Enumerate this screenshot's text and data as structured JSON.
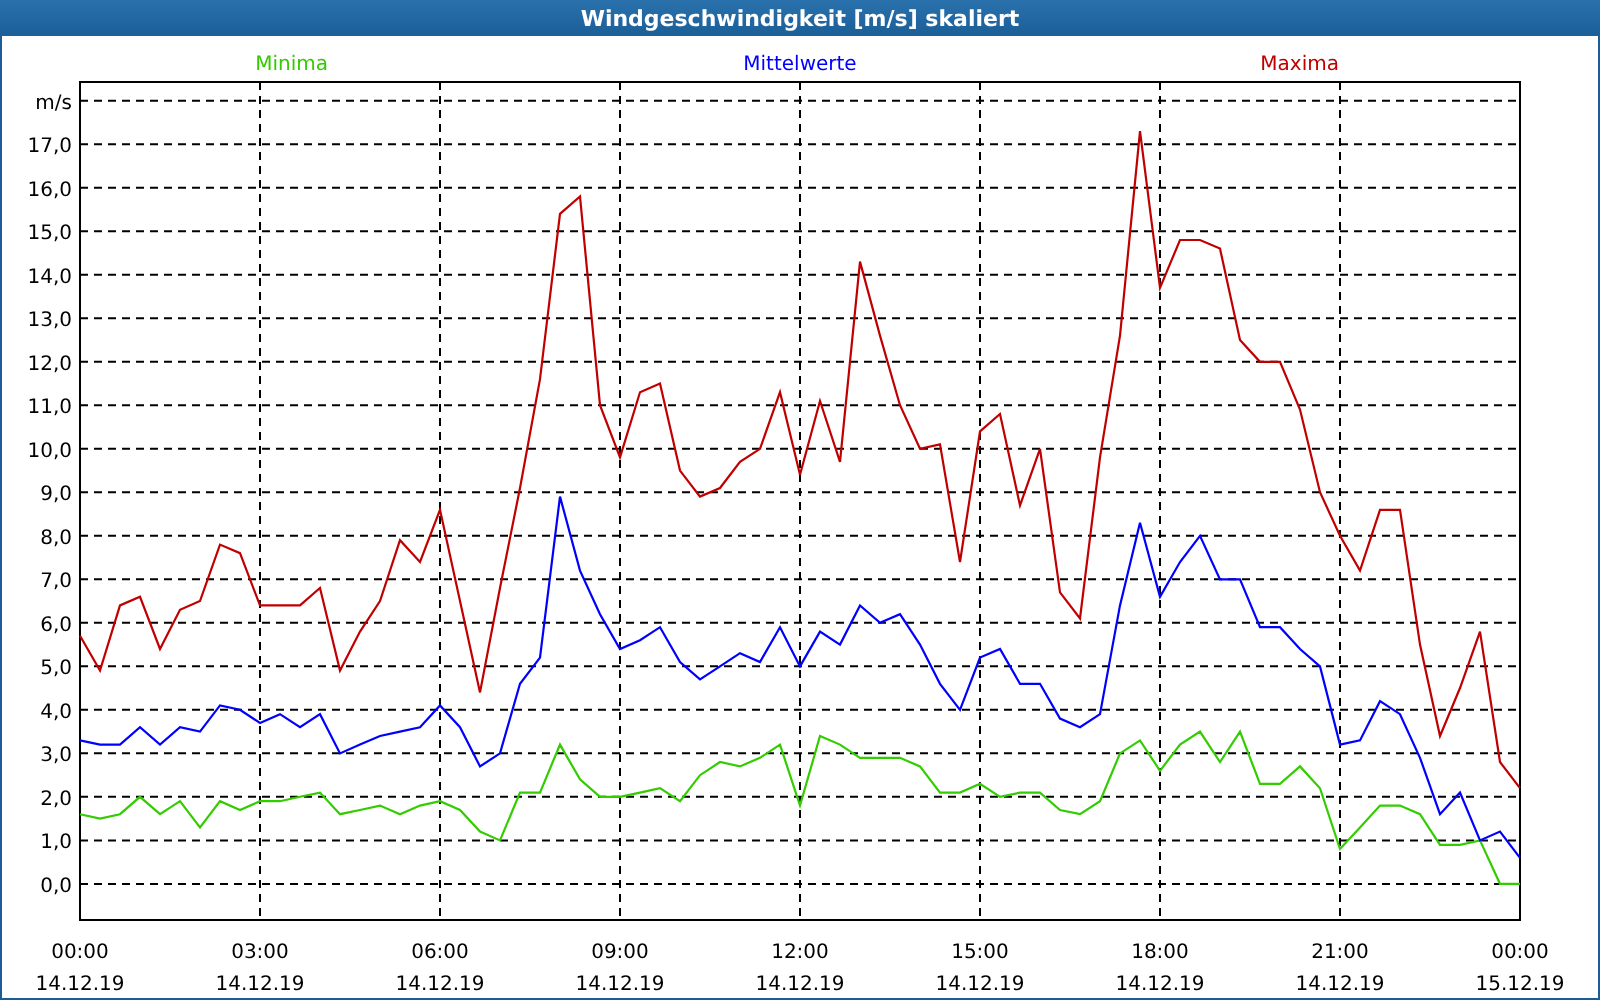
{
  "window": {
    "title": "Windgeschwindigkeit [m/s] skaliert"
  },
  "chart": {
    "chart_data": {
      "type": "line",
      "grid": true,
      "categories": [
        "00:00\n14.12.19",
        null,
        null,
        null,
        null,
        null,
        null,
        null,
        null,
        "03:00\n14.12.19",
        null,
        null,
        null,
        null,
        null,
        null,
        null,
        null,
        "06:00\n14.12.19",
        null,
        null,
        null,
        null,
        null,
        null,
        null,
        null,
        "09:00\n14.12.19",
        null,
        null,
        null,
        null,
        null,
        null,
        null,
        null,
        "12:00\n14.12.19",
        null,
        null,
        null,
        null,
        null,
        null,
        null,
        null,
        "15:00\n14.12.19",
        null,
        null,
        null,
        null,
        null,
        null,
        null,
        null,
        "18:00\n14.12.19",
        null,
        null,
        null,
        null,
        null,
        null,
        null,
        null,
        "21:00\n14.12.19",
        null,
        null,
        null,
        null,
        null,
        null,
        null,
        null,
        "00:00\n15.12.19"
      ],
      "series": [
        {
          "name": "Minima",
          "color": "#33cc00",
          "values": [
            1.6,
            1.5,
            1.6,
            2.0,
            1.6,
            1.9,
            1.3,
            1.9,
            1.7,
            1.9,
            1.9,
            2.0,
            2.1,
            1.6,
            1.7,
            1.8,
            1.6,
            1.8,
            1.9,
            1.7,
            1.2,
            1.0,
            2.1,
            2.1,
            3.2,
            2.4,
            2.0,
            2.0,
            2.1,
            2.2,
            1.9,
            2.5,
            2.8,
            2.7,
            2.9,
            3.2,
            1.8,
            3.4,
            3.2,
            2.9,
            2.9,
            2.9,
            2.7,
            2.1,
            2.1,
            2.3,
            2.0,
            2.1,
            2.1,
            1.7,
            1.6,
            1.9,
            3.0,
            3.3,
            2.6,
            3.2,
            3.5,
            2.8,
            3.5,
            2.3,
            2.3,
            2.7,
            2.2,
            0.8,
            1.3,
            1.8,
            1.8,
            1.6,
            0.9,
            0.9,
            1.0,
            0.0,
            0.0
          ]
        },
        {
          "name": "Mittelwerte",
          "color": "#0000ff",
          "values": [
            3.3,
            3.2,
            3.2,
            3.6,
            3.2,
            3.6,
            3.5,
            4.1,
            4.0,
            3.7,
            3.9,
            3.6,
            3.9,
            3.0,
            3.2,
            3.4,
            3.5,
            3.6,
            4.1,
            3.6,
            2.7,
            3.0,
            4.6,
            5.2,
            8.9,
            7.2,
            6.2,
            5.4,
            5.6,
            5.9,
            5.1,
            4.7,
            5.0,
            5.3,
            5.1,
            5.9,
            5.0,
            5.8,
            5.5,
            6.4,
            6.0,
            6.2,
            5.5,
            4.6,
            4.0,
            5.2,
            5.4,
            4.6,
            4.6,
            3.8,
            3.6,
            3.9,
            6.4,
            8.3,
            6.6,
            7.4,
            8.0,
            7.0,
            7.0,
            5.9,
            5.9,
            5.4,
            5.0,
            3.2,
            3.3,
            4.2,
            3.9,
            2.9,
            1.6,
            2.1,
            1.0,
            1.2,
            0.6
          ]
        },
        {
          "name": "Maxima",
          "color": "#c00000",
          "values": [
            5.7,
            4.9,
            6.4,
            6.6,
            5.4,
            6.3,
            6.5,
            7.8,
            7.6,
            6.4,
            6.4,
            6.4,
            6.8,
            4.9,
            5.8,
            6.5,
            7.9,
            7.4,
            8.6,
            6.5,
            4.4,
            6.8,
            9.1,
            11.6,
            15.4,
            15.8,
            11.0,
            9.8,
            11.3,
            11.5,
            9.5,
            8.9,
            9.1,
            9.7,
            10.0,
            11.3,
            9.4,
            11.1,
            9.7,
            14.3,
            12.6,
            11.0,
            10.0,
            10.1,
            7.4,
            10.4,
            10.8,
            8.7,
            10.0,
            6.7,
            6.1,
            9.8,
            12.6,
            17.3,
            13.7,
            14.8,
            14.8,
            14.6,
            12.5,
            12.0,
            12.0,
            10.9,
            9.0,
            8.0,
            7.2,
            8.6,
            8.6,
            5.5,
            3.4,
            4.5,
            5.8,
            2.8,
            2.2
          ]
        }
      ],
      "ylim": [
        -0.83,
        18.43
      ],
      "yticks": [
        {
          "value": 0,
          "label": "0,0"
        },
        {
          "value": 1,
          "label": "1,0"
        },
        {
          "value": 2,
          "label": "2,0"
        },
        {
          "value": 3,
          "label": "3,0"
        },
        {
          "value": 4,
          "label": "4,0"
        },
        {
          "value": 5,
          "label": "5,0"
        },
        {
          "value": 6,
          "label": "6,0"
        },
        {
          "value": 7,
          "label": "7,0"
        },
        {
          "value": 8,
          "label": "8,0"
        },
        {
          "value": 9,
          "label": "9,0"
        },
        {
          "value": 10,
          "label": "10,0"
        },
        {
          "value": 11,
          "label": "11,0"
        },
        {
          "value": 12,
          "label": "12,0"
        },
        {
          "value": 13,
          "label": "13,0"
        },
        {
          "value": 14,
          "label": "14,0"
        },
        {
          "value": 15,
          "label": "15,0"
        },
        {
          "value": 16,
          "label": "16,0"
        },
        {
          "value": 17,
          "label": "17,0"
        },
        {
          "value": 18,
          "label": "m/s"
        }
      ]
    }
  }
}
